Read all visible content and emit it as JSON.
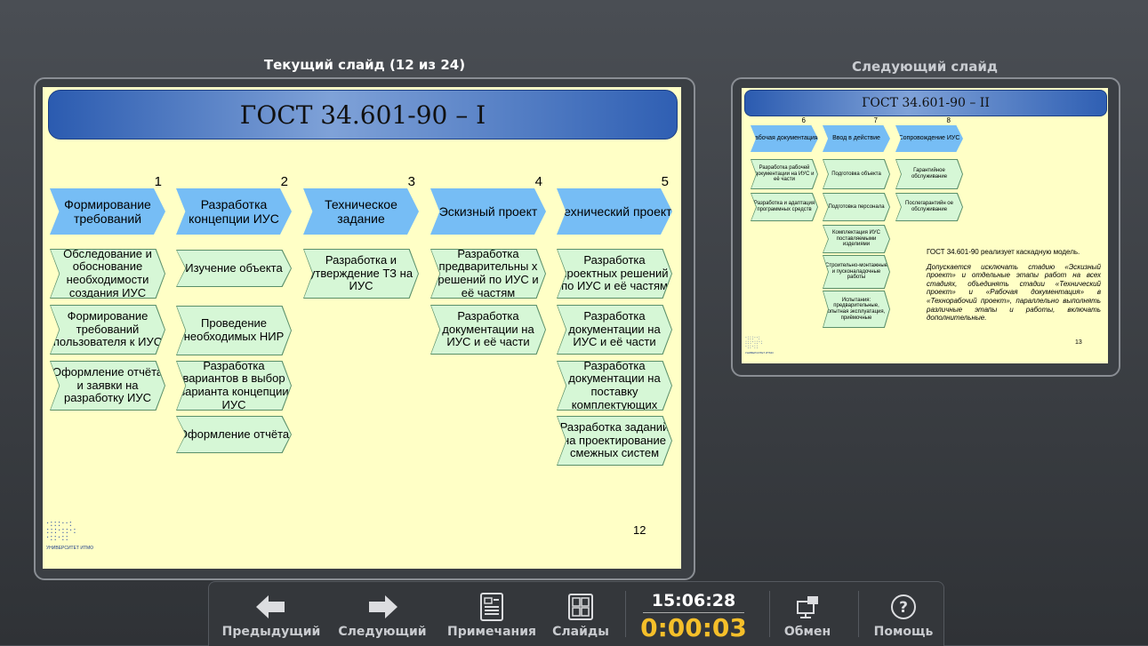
{
  "labels": {
    "current": "Текущий слайд (12 из 24)",
    "next": "Следующий слайд"
  },
  "current_slide": {
    "title": "ГОСТ 34.601-90 – I",
    "page_number": "12",
    "logo_caption": "УНИВЕРСИТЕТ ИТМО",
    "columns": [
      {
        "num": "1",
        "header": "Формирование требований",
        "items": [
          "Обследование и обоснование необходимости создания ИУС",
          "Формирование требований пользователя к ИУС",
          "Оформление отчёта и заявки на разработку ИУС"
        ]
      },
      {
        "num": "2",
        "header": "Разработка концепции ИУС",
        "items": [
          "Изучение объекта",
          "Проведение необходимых НИР",
          "Разработка вариантов в выбор варианта концепции ИУС",
          "Оформление отчёта"
        ]
      },
      {
        "num": "3",
        "header": "Техническое задание",
        "items": [
          "Разработка и утверждение ТЗ на ИУС"
        ]
      },
      {
        "num": "4",
        "header": "Эскизный проект",
        "items": [
          "Разработка предварительны х решений по ИУС и её частям",
          "Разработка документации на ИУС и её части"
        ]
      },
      {
        "num": "5",
        "header": "Технический проект",
        "items": [
          "Разработка проектных решений по ИУС и её частям",
          "Разработка документации на ИУС и её части",
          "Разработка документации на поставку комплектующих",
          "Разработка заданий на проектирование смежных систем"
        ]
      }
    ]
  },
  "next_slide": {
    "title": "ГОСТ 34.601-90 – II",
    "page_number": "13",
    "logo_caption": "УНИВЕРСИТЕТ ИТМО",
    "columns": [
      {
        "num": "6",
        "header": "Рабочая документация",
        "items": [
          "Разработка рабочей документации на ИУС и её части",
          "Разработка и адаптация программных средств"
        ]
      },
      {
        "num": "7",
        "header": "Ввод в действие",
        "items": [
          "Подготовка объекта",
          "Подготовка персонала",
          "Комплектация ИУС поставляемыми изделиями",
          "Строительно-монтажные и пусконаладочные работы",
          "Испытания: предварительные, опытная эксплуатация, приёмочные"
        ]
      },
      {
        "num": "8",
        "header": "Сопровождение ИУС",
        "items": [
          "Гарантийное обслуживание",
          "Послегарантийн ое обслуживание"
        ]
      }
    ],
    "note_1": "ГОСТ 34.601-90 реализует каскадную модель.",
    "note_2": "Допускается исключать стадию «Эскизный проект» и отдельные этапы работ на всех стадиях, объединять стадии «Технический проект» и «Рабочая документация» в «Технорабочий проект», параллельно выполнять различные этапы и работы, включать дополнительные."
  },
  "toolbar": {
    "prev_label": "Предыдущий",
    "next_label": "Следующий",
    "notes_label": "Примечания",
    "slides_label": "Слайды",
    "clock_time": "15:06:28",
    "elapsed": "0:00:03",
    "exchange_label": "Обмен",
    "help_label": "Помощь"
  },
  "colors": {
    "slide_bg": "#ffffc6",
    "header_arrow": "#76bdf5",
    "item_box": "#d6f7d6",
    "elapsed": "#f5bf2a"
  }
}
